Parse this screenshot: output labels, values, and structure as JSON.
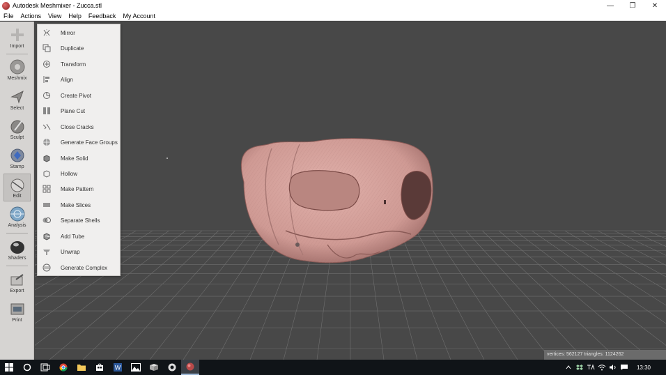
{
  "window": {
    "title": "Autodesk Meshmixer - Zucca.stl",
    "min_glyph": "—",
    "restore_glyph": "❐",
    "close_glyph": "✕"
  },
  "menu": [
    "File",
    "Actions",
    "View",
    "Help",
    "Feedback",
    "My Account"
  ],
  "toolbar": {
    "tools": [
      {
        "label": "Import",
        "icon": "import-icon"
      },
      {
        "label": "Meshmix",
        "icon": "meshmix-icon"
      },
      {
        "label": "Select",
        "icon": "select-icon"
      },
      {
        "label": "Sculpt",
        "icon": "sculpt-icon"
      },
      {
        "label": "Stamp",
        "icon": "stamp-icon"
      },
      {
        "label": "Edit",
        "icon": "edit-icon",
        "active": true
      },
      {
        "label": "Analysis",
        "icon": "analysis-icon"
      },
      {
        "label": "Shaders",
        "icon": "shaders-icon"
      },
      {
        "label": "Export",
        "icon": "export-icon"
      },
      {
        "label": "Print",
        "icon": "print-icon"
      }
    ]
  },
  "edit_menu": {
    "items": [
      {
        "label": "Mirror",
        "icon": "mirror-icon"
      },
      {
        "label": "Duplicate",
        "icon": "duplicate-icon"
      },
      {
        "label": "Transform",
        "icon": "transform-icon"
      },
      {
        "label": "Align",
        "icon": "align-icon"
      },
      {
        "label": "Create Pivot",
        "icon": "pivot-icon"
      },
      {
        "label": "Plane Cut",
        "icon": "plane-cut-icon"
      },
      {
        "label": "Close Cracks",
        "icon": "close-cracks-icon"
      },
      {
        "label": "Generate Face Groups",
        "icon": "face-groups-icon"
      },
      {
        "label": "Make Solid",
        "icon": "make-solid-icon"
      },
      {
        "label": "Hollow",
        "icon": "hollow-icon"
      },
      {
        "label": "Make Pattern",
        "icon": "pattern-icon"
      },
      {
        "label": "Make Slices",
        "icon": "slices-icon"
      },
      {
        "label": "Separate Shells",
        "icon": "shells-icon"
      },
      {
        "label": "Add Tube",
        "icon": "tube-icon"
      },
      {
        "label": "Unwrap",
        "icon": "unwrap-icon"
      },
      {
        "label": "Generate Complex",
        "icon": "complex-icon"
      }
    ]
  },
  "status_bar": {
    "text": "vertices: 562127 triangles: 1124262"
  },
  "taskbar": {
    "clock": "13:30",
    "apps": [
      "start-icon",
      "search-icon",
      "task-view-icon",
      "chrome-icon",
      "file-explorer-icon",
      "store-icon",
      "word-icon",
      "photos-icon",
      "app-icon",
      "browser-icon",
      "meshmixer-icon"
    ],
    "tray": [
      "chevron-up-icon",
      "dropbox-icon",
      "ime-icon",
      "network-icon",
      "volume-icon",
      "notification-icon"
    ]
  },
  "colors": {
    "viewport_bg": "#484848",
    "grid": "#8a8a8a",
    "model": "#d4a09a",
    "toolbar_bg": "#d6d4d2",
    "menu_bg": "#f0efee"
  }
}
